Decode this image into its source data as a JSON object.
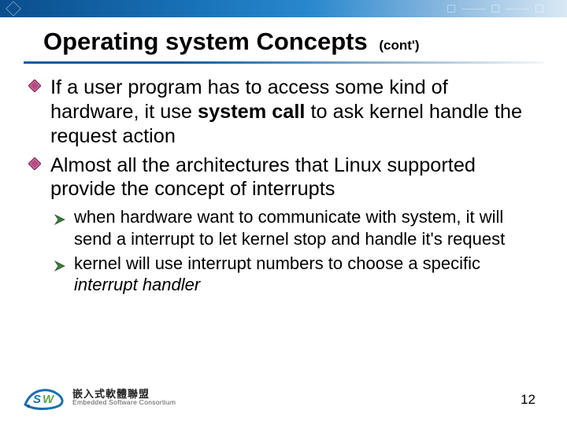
{
  "title": {
    "main": "Operating system Concepts",
    "suffix": "(cont')"
  },
  "bullets_l1": [
    {
      "pre": "If a user program has to access some kind of hardware, it use ",
      "strong": "system call",
      "post": " to ask kernel handle the request action"
    },
    {
      "pre": "Almost all the architectures that Linux supported provide the concept of interrupts",
      "strong": "",
      "post": ""
    }
  ],
  "bullets_l2": [
    {
      "pre": "when hardware want to communicate with system, it will send a interrupt to let kernel stop and handle it's request",
      "italic": ""
    },
    {
      "pre": "kernel will use interrupt numbers to choose a specific ",
      "italic": "interrupt handler"
    }
  ],
  "footer": {
    "cjk": "嵌入式軟體聯盟",
    "en": "Embedded Software Consortium"
  },
  "slide_number": "12",
  "colors": {
    "accent": "#0b5ca0",
    "diamond_fill": "#b64a84",
    "diamond_stroke": "#7a2d58",
    "arrow_fill": "#3b7a3b"
  }
}
